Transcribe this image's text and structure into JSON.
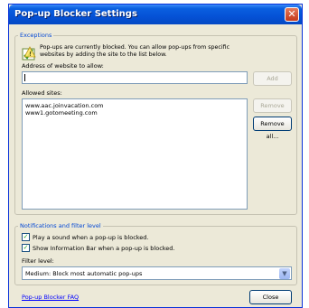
{
  "window": {
    "title": "Pop-up Blocker Settings",
    "close_glyph": "✕"
  },
  "exceptions": {
    "legend": "Exceptions",
    "info_line1": "Pop-ups are currently blocked.  You can allow pop-ups from specific",
    "info_line2": "websites by adding the site to the list below.",
    "address_label": "Address of website to allow:",
    "address_value": "",
    "add_label": "Add",
    "allowed_label": "Allowed sites:",
    "allowed_sites": [
      "www.aac.joinvacation.com",
      "www1.gotomeeting.com"
    ],
    "remove_label": "Remove",
    "remove_all_label": "Remove all..."
  },
  "notifications": {
    "legend": "Notifications and filter level",
    "play_sound_label": "Play a sound when a pop-up is blocked.",
    "play_sound_checked": true,
    "info_bar_label": "Show Information Bar when a pop-up is blocked.",
    "info_bar_checked": true,
    "filter_label": "Filter level:",
    "filter_value": "Medium: Block most automatic pop-ups"
  },
  "footer": {
    "faq_link": "Pop-up Blocker FAQ",
    "close_label": "Close"
  },
  "colors": {
    "title_bar": "#0552d6",
    "legend_text": "#0046d5",
    "link": "#0000ff",
    "close_button": "#c4391a"
  }
}
